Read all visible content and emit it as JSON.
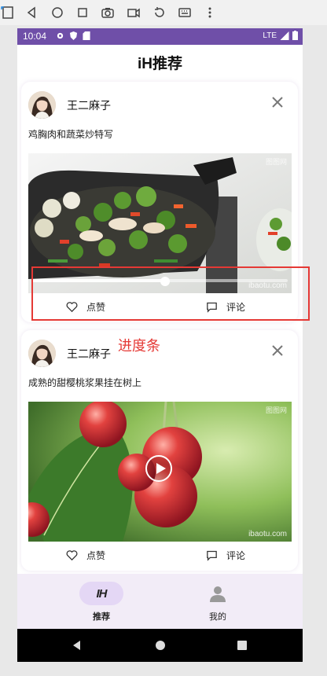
{
  "emulator_toolbar": {
    "icons": [
      "rotate-icon",
      "back-icon",
      "home-icon",
      "overview-icon",
      "camera-icon",
      "video-icon",
      "replay-icon",
      "keyboard-icon",
      "more-icon"
    ]
  },
  "status_bar": {
    "time": "10:04",
    "network": "LTE",
    "color": "#6f4fa8"
  },
  "app": {
    "title": "iH推荐"
  },
  "feed": {
    "posts": [
      {
        "author": "王二麻子",
        "caption": "鸡胸肉和蔬菜炒特写",
        "watermark_top": "图图网",
        "watermark_bottom": "ibaotu.com",
        "progress": 0.52,
        "like_label": "点赞",
        "comment_label": "评论"
      },
      {
        "author": "王二麻子",
        "caption": "成熟的甜樱桃浆果挂在树上",
        "watermark_top": "图图网",
        "watermark_bottom": "ibaotu.com",
        "like_label": "点赞",
        "comment_label": "评论"
      }
    ]
  },
  "annotation": {
    "label": "进度条",
    "color": "#e53935"
  },
  "bottom_nav": {
    "items": [
      {
        "label": "推荐",
        "icon": "ih-logo",
        "active": true
      },
      {
        "label": "我的",
        "icon": "person-icon",
        "active": false
      }
    ]
  }
}
